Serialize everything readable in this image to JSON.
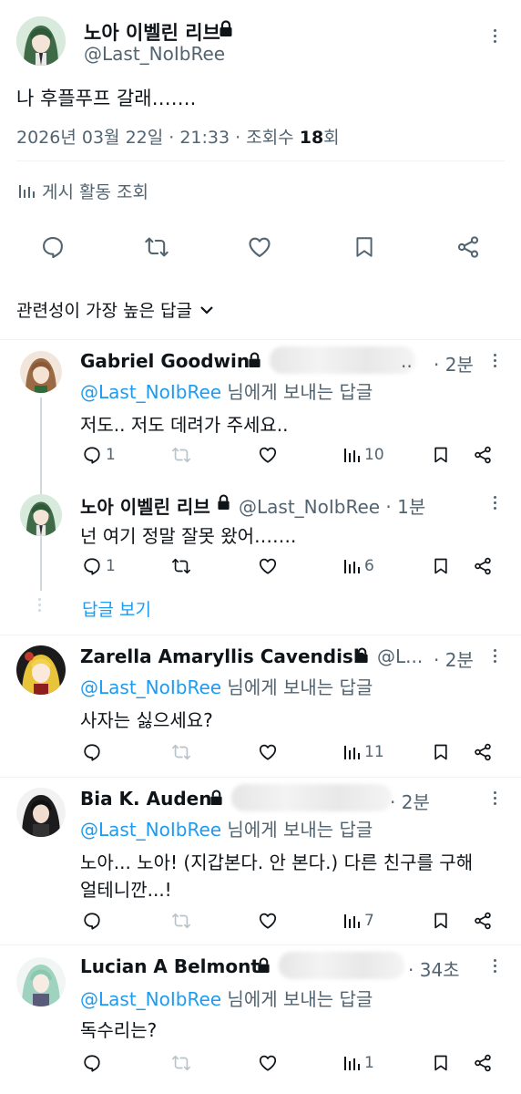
{
  "main_tweet": {
    "display_name": "노아 이벨린 리브",
    "handle": "@Last_NoIbRee",
    "text": "나 후플푸프 갈래…….",
    "meta_date": "2026년 03월 22일 · 21:33 · 조회수",
    "views_count": "18",
    "views_suffix": "회",
    "analytics_label": "게시 활동 조회"
  },
  "sort_label": "관련성이 가장 높은 답글",
  "replies": [
    {
      "display_name": "Gabriel Goodwin",
      "handle_tail": "..",
      "time": "· 2분",
      "reply_to": "@Last_NoIbRee",
      "reply_to_suffix": "님에게 보내는 답글",
      "text": "저도.. 저도 데려가 주세요..",
      "replies": "1",
      "views": "10"
    },
    {
      "display_name": "노아 이벨린 리브",
      "handle": "@Last_NoIbRee · 1분",
      "text": "넌 여기 정말 잘못 왔어…….",
      "replies": "1",
      "views": "6",
      "show_replies": "답글 보기"
    },
    {
      "display_name": "Zarella Amaryllis Cavendish",
      "handle": "@L...",
      "time": "· 2분",
      "reply_to": "@Last_NoIbRee",
      "reply_to_suffix": "님에게 보내는 답글",
      "text": "사자는 싫으세요?",
      "views": "11"
    },
    {
      "display_name": "Bia K. Auden",
      "time": "· 2분",
      "reply_to": "@Last_NoIbRee",
      "reply_to_suffix": "님에게 보내는 답글",
      "text_line1": "노아... 노아! (지갑본다. 안 본다.) 다른 친구를 구해",
      "text_line2": "얼테니깐...!",
      "views": "7"
    },
    {
      "display_name": "Lucian A Belmont",
      "time": "· 34초",
      "reply_to": "@Last_NoIbRee",
      "reply_to_suffix": "님에게 보내는 답글",
      "text": "독수리는?",
      "views": "1"
    }
  ],
  "colors": {
    "text": "#0f1419",
    "secondary": "#536471",
    "link": "#1d9bf0",
    "divider": "#eff3f4"
  },
  "icons": [
    "lock-icon",
    "more-icon",
    "reply-icon",
    "retweet-icon",
    "like-icon",
    "bookmark-icon",
    "share-icon",
    "analytics-icon",
    "chevron-down-icon"
  ]
}
